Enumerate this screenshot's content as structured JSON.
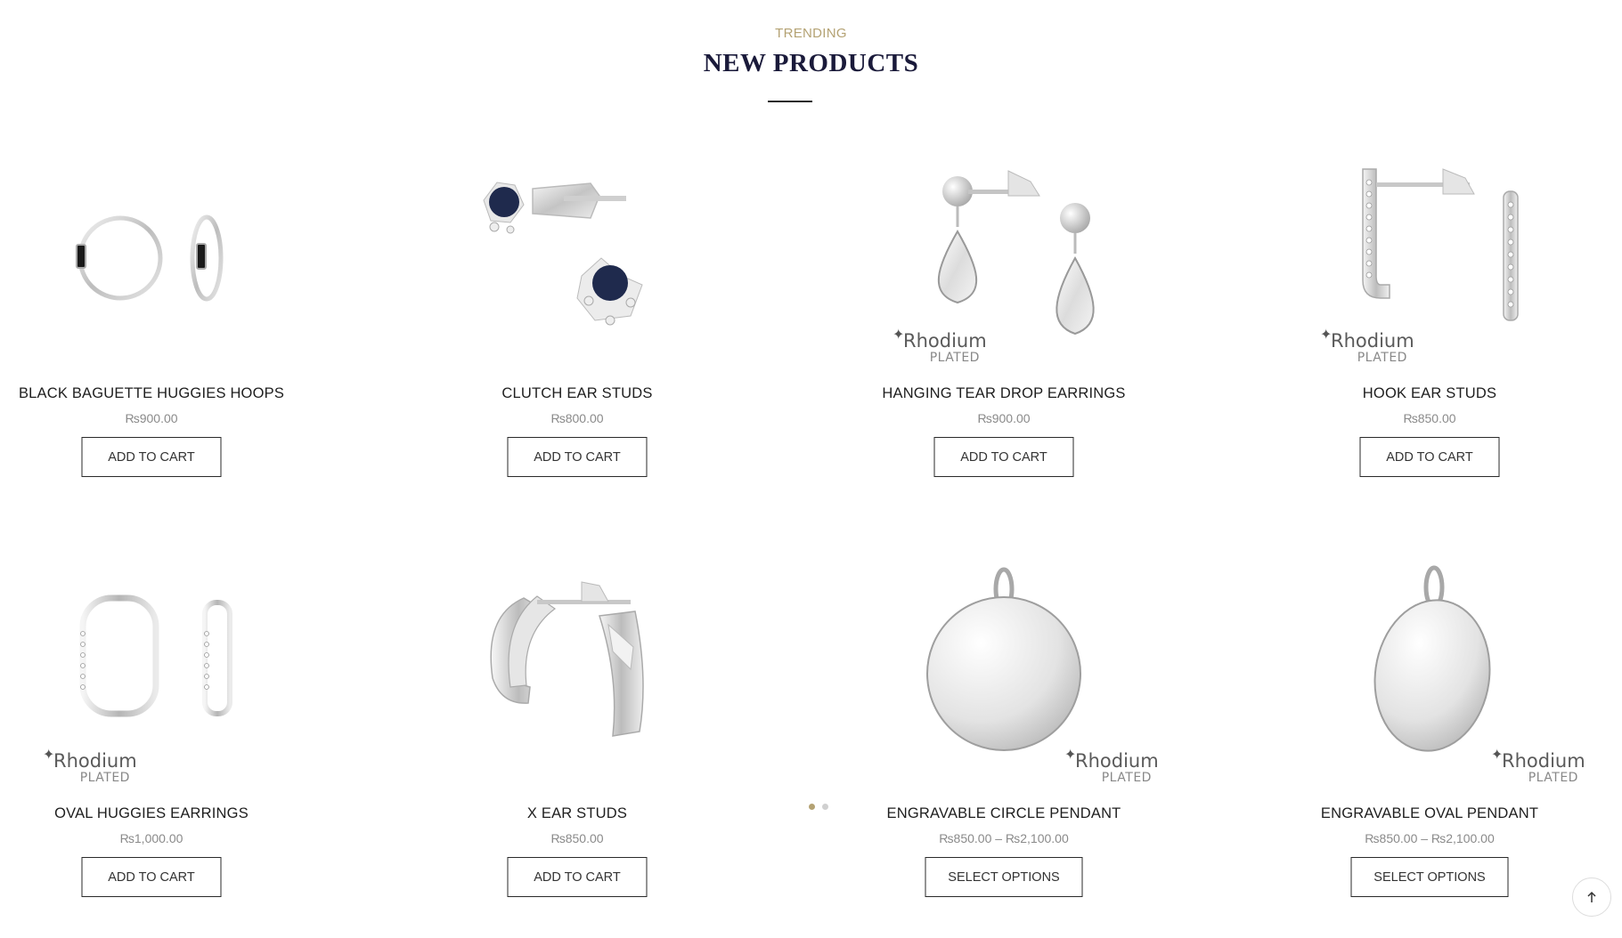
{
  "section": {
    "eyebrow": "TRENDING",
    "title": "NEW PRODUCTS"
  },
  "badge": {
    "line1": "Rhodium",
    "line2": "PLATED"
  },
  "products": [
    {
      "name": "BLACK BAGUETTE HUGGIES HOOPS",
      "price": "₨900.00",
      "button": "ADD TO CART",
      "rhodium": false
    },
    {
      "name": "CLUTCH EAR STUDS",
      "price": "₨800.00",
      "button": "ADD TO CART",
      "rhodium": false
    },
    {
      "name": "HANGING TEAR DROP EARRINGS",
      "price": "₨900.00",
      "button": "ADD TO CART",
      "rhodium": true
    },
    {
      "name": "HOOK EAR STUDS",
      "price": "₨850.00",
      "button": "ADD TO CART",
      "rhodium": true
    },
    {
      "name": "OVAL HUGGIES EARRINGS",
      "price": "₨1,000.00",
      "button": "ADD TO CART",
      "rhodium": true
    },
    {
      "name": "X EAR STUDS",
      "price": "₨850.00",
      "button": "ADD TO CART",
      "rhodium": false
    },
    {
      "name": "ENGRAVABLE CIRCLE PENDANT",
      "price": "₨850.00 – ₨2,100.00",
      "button": "SELECT OPTIONS",
      "rhodium": true
    },
    {
      "name": "ENGRAVABLE OVAL PENDANT",
      "price": "₨850.00 – ₨2,100.00",
      "button": "SELECT OPTIONS",
      "rhodium": true
    }
  ],
  "carousel": {
    "active_index": 0,
    "count": 2
  },
  "colors": {
    "accent": "#b4a273",
    "title": "#1a1a3a",
    "dot_active": "#b4a273",
    "dot_inactive": "#d0d0d0"
  },
  "scroll_top": {
    "icon": "arrow-up-icon"
  }
}
